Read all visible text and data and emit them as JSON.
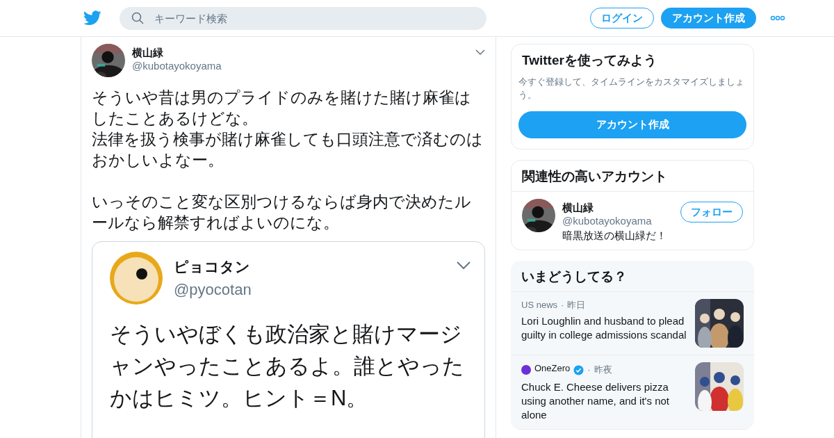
{
  "header": {
    "search": {
      "placeholder": "キーワード検索"
    },
    "login": "ログイン",
    "signup": "アカウント作成"
  },
  "tweet": {
    "name": "横山緑",
    "handle": "@kubotayokoyama",
    "paragraphs": [
      [
        "そういや昔は男のプライドのみを賭けた賭け麻雀はしたことあるけどな。",
        "法律を扱う検事が賭け麻雀しても口頭注意で済むのはおかしいよなー。"
      ],
      [
        "いっそのこと変な区別つけるならば身内で決めたルールなら解禁すればよいのにな。"
      ]
    ],
    "quoted_screenshot": {
      "name": "ピョコタン",
      "handle": "@pyocotan",
      "text": "そういやぼくも政治家と賭けマージャンやったことあるよ。誰とやったかはヒミツ。ヒント＝N。"
    }
  },
  "signup_card": {
    "title": "Twitterを使ってみよう",
    "description": "今すぐ登録して、タイムラインをカスタマイズしましょう。",
    "button": "アカウント作成"
  },
  "related_card": {
    "title": "関連性の高いアカウント",
    "accounts": [
      {
        "name": "横山緑",
        "handle": "@kubotayokoyama",
        "bio": "暗黒放送の横山緑だ！",
        "follow": "フォロー"
      }
    ]
  },
  "trends_card": {
    "title": "いまどうしてる？",
    "items": [
      {
        "source": "US news",
        "logo": false,
        "verified": false,
        "separator": "·",
        "time": "昨日",
        "headline": "Lori Loughlin and husband to plead guilty in college admissions scandal",
        "kind": "picture"
      },
      {
        "source": "OneZero",
        "logo": true,
        "verified": true,
        "separator": "·",
        "time": "昨夜",
        "headline": "Chuck E. Cheese delivers pizza using another name, and it's not alone",
        "kind": "picture"
      }
    ]
  }
}
